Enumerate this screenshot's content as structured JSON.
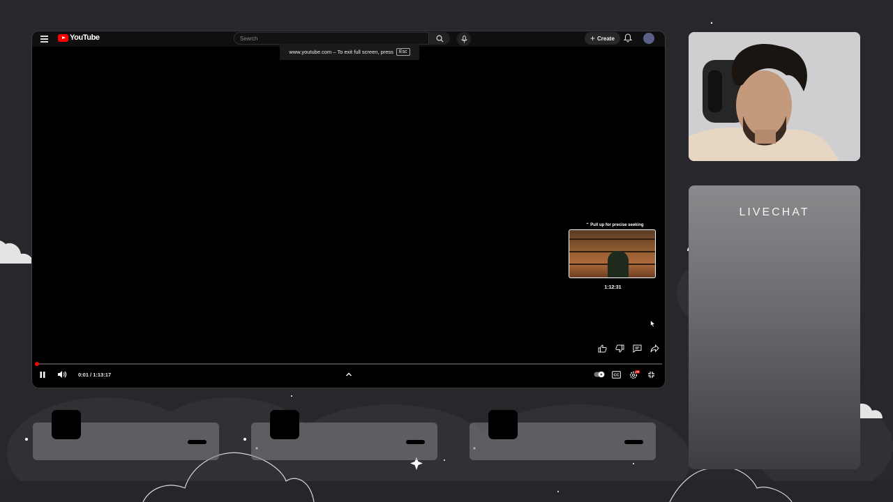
{
  "colors": {
    "background": "#28282c",
    "accent": "#ff0000",
    "panel": "#8a8a8d"
  },
  "youtube": {
    "logo_text": "YouTube",
    "search_placeholder": "Search",
    "create_label": "Create",
    "fullscreen_toast_text": "www.youtube.com – To exit full screen, press",
    "fullscreen_toast_key": "Esc",
    "icons": [
      "hamburger-icon",
      "search-icon",
      "mic-icon",
      "plus-icon",
      "bell-icon",
      "avatar"
    ]
  },
  "player": {
    "seek_hint": "⌃ Pull up for precise seeking",
    "preview_time": "1:12:31",
    "current_time": "0:01",
    "duration": "1:13:17",
    "time_display": "0:01 / 1:13:17",
    "progress_fraction": 0.0002,
    "action_icons": [
      "like-icon",
      "dislike-icon",
      "comment-icon",
      "share-icon"
    ],
    "control_icons": [
      "pause-icon",
      "volume-icon",
      "chevron-up-icon",
      "autoplay-toggle-icon",
      "captions-icon",
      "settings-icon",
      "exit-fullscreen-icon"
    ],
    "captions_label": "CC",
    "settings_badge": "HD"
  },
  "livechat": {
    "title": "LIVECHAT"
  },
  "cards": [
    {
      "id": "card-1"
    },
    {
      "id": "card-2"
    },
    {
      "id": "card-3"
    }
  ]
}
